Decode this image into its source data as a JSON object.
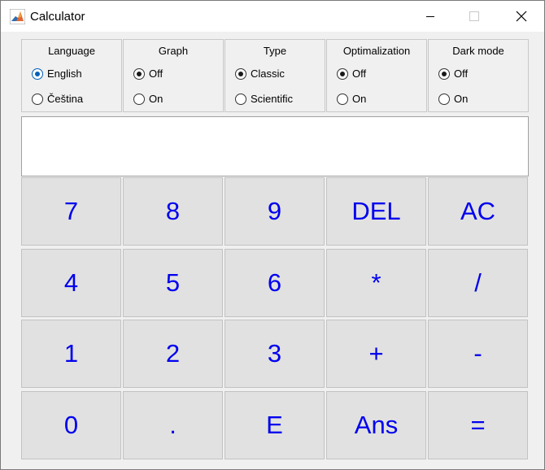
{
  "window": {
    "title": "Calculator",
    "icon": "matlab-logo-icon"
  },
  "panels": [
    {
      "title": "Language",
      "options": [
        "English",
        "Čeština"
      ],
      "selected": 0
    },
    {
      "title": "Graph",
      "options": [
        "Off",
        "On"
      ],
      "selected": 0
    },
    {
      "title": "Type",
      "options": [
        "Classic",
        "Scientific"
      ],
      "selected": 0
    },
    {
      "title": "Optimalization",
      "options": [
        "Off",
        "On"
      ],
      "selected": 0
    },
    {
      "title": "Dark mode",
      "options": [
        "Off",
        "On"
      ],
      "selected": 0
    }
  ],
  "display": {
    "value": ""
  },
  "keys": [
    [
      "7",
      "8",
      "9",
      "DEL",
      "AC"
    ],
    [
      "4",
      "5",
      "6",
      "*",
      "/"
    ],
    [
      "1",
      "2",
      "3",
      "+",
      "-"
    ],
    [
      "0",
      ".",
      "E",
      "Ans",
      "="
    ]
  ],
  "colors": {
    "key_text": "#0000ee",
    "key_bg": "#e1e1e1"
  }
}
